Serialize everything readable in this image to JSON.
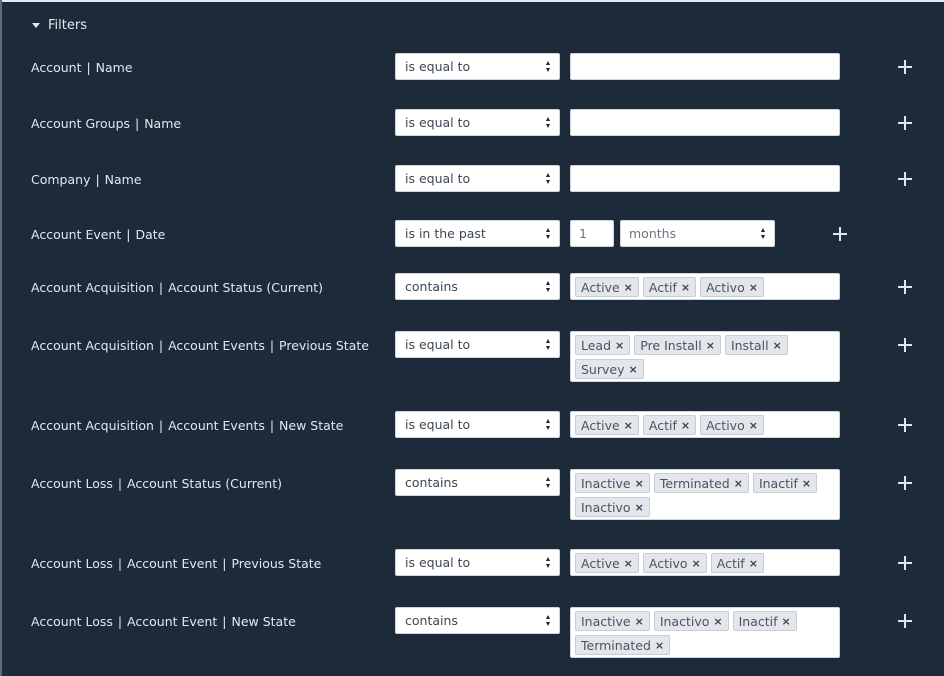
{
  "section": {
    "title": "Filters"
  },
  "filters": [
    {
      "label": [
        "Account",
        "Name"
      ],
      "operator": "is equal to",
      "value": "",
      "tags": []
    },
    {
      "label": [
        "Account Groups",
        "Name"
      ],
      "operator": "is equal to",
      "value": "",
      "tags": []
    },
    {
      "label": [
        "Company",
        "Name"
      ],
      "operator": "is equal to",
      "value": "",
      "tags": []
    },
    {
      "label": [
        "Account Event",
        "Date"
      ],
      "operator": "is in the past",
      "number": "1",
      "unit": "months"
    },
    {
      "label": [
        "Account Acquisition",
        "Account Status (Current)"
      ],
      "operator": "contains",
      "tags": [
        "Active",
        "Actif",
        "Activo"
      ]
    },
    {
      "label": [
        "Account Acquisition",
        "Account Events",
        "Previous State"
      ],
      "operator": "is equal to",
      "tags": [
        "Lead",
        "Pre Install",
        "Install",
        "Survey"
      ]
    },
    {
      "label": [
        "Account Acquisition",
        "Account Events",
        "New State"
      ],
      "operator": "is equal to",
      "tags": [
        "Active",
        "Actif",
        "Activo"
      ]
    },
    {
      "label": [
        "Account Loss",
        "Account Status (Current)"
      ],
      "operator": "contains",
      "tags": [
        "Inactive",
        "Terminated",
        "Inactif",
        "Inactivo"
      ]
    },
    {
      "label": [
        "Account Loss",
        "Account Event",
        "Previous State"
      ],
      "operator": "is equal to",
      "tags": [
        "Active",
        "Activo",
        "Actif"
      ]
    },
    {
      "label": [
        "Account Loss",
        "Account Event",
        "New State"
      ],
      "operator": "contains",
      "tags": [
        "Inactive",
        "Inactivo",
        "Inactif",
        "Terminated"
      ]
    }
  ],
  "icons": {
    "remove_tag": "×",
    "add": "plus-icon",
    "collapse": "caret-down-icon",
    "select": "select-arrows-icon"
  }
}
